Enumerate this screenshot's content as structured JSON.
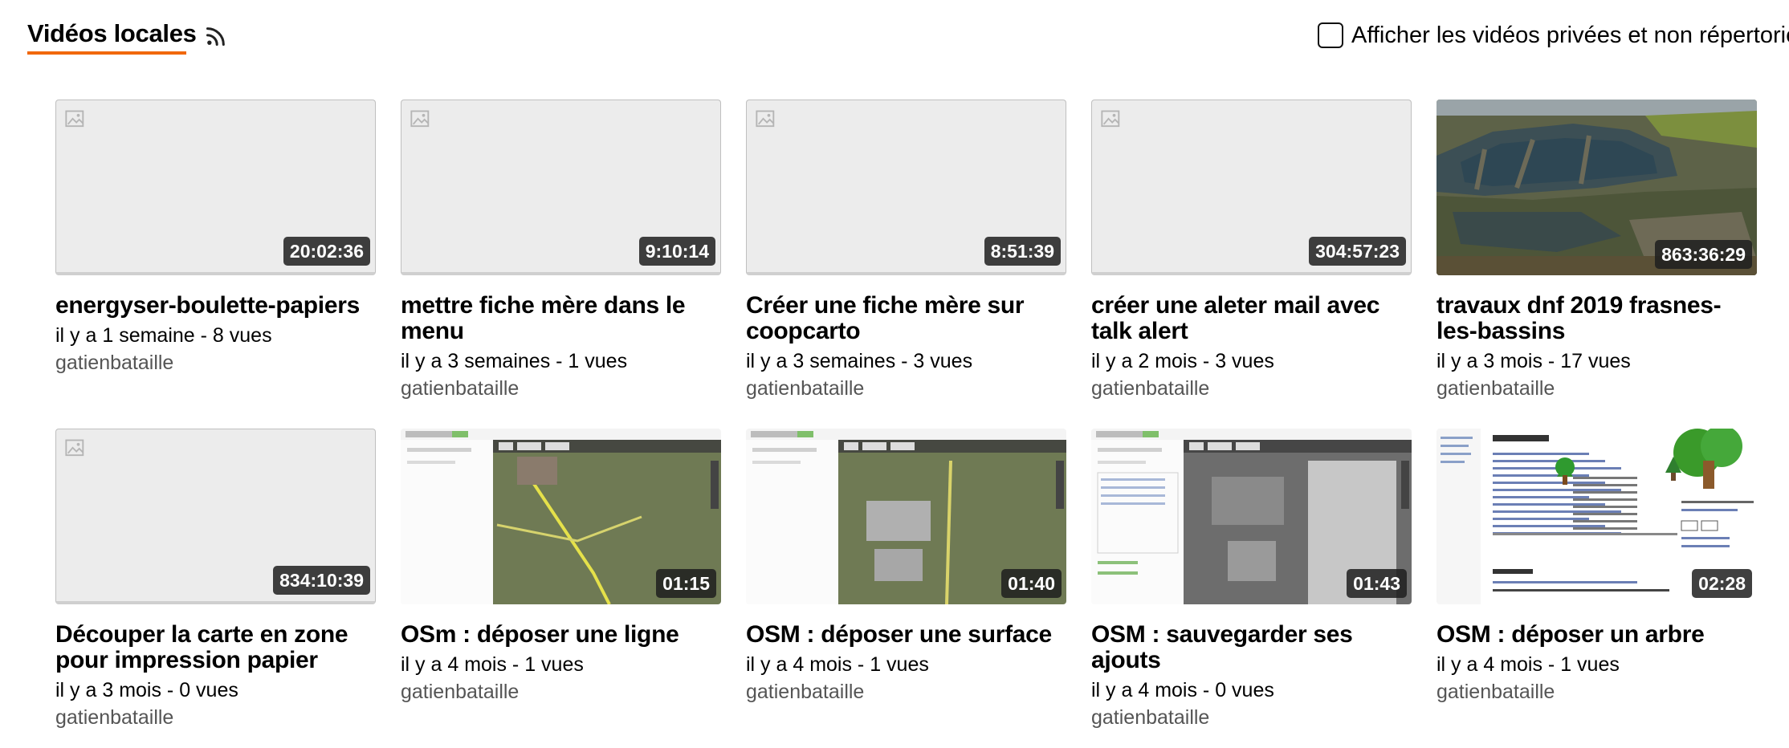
{
  "header": {
    "title": "Vidéos locales",
    "rss_icon": "rss-feed-icon",
    "private_toggle_label": "Afficher les vidéos privées et non répertoriées",
    "private_toggle_checked": false
  },
  "colors": {
    "accent": "#f1680d",
    "duration_bg": "#2b2b2b",
    "placeholder_bg": "#ececec"
  },
  "videos": [
    {
      "title": "energyser-boulette-papiers",
      "meta": "il y a 1 semaine - 8 vues",
      "channel": "gatienbataille",
      "duration": "20:02:36",
      "thumb": "placeholder"
    },
    {
      "title": "mettre fiche mère dans le menu",
      "meta": "il y a 3 semaines - 1 vues",
      "channel": "gatienbataille",
      "duration": "9:10:14",
      "thumb": "placeholder"
    },
    {
      "title": "Créer une fiche mère sur coopcarto",
      "meta": "il y a 3 semaines - 3 vues",
      "channel": "gatienbataille",
      "duration": "8:51:39",
      "thumb": "placeholder"
    },
    {
      "title": "créer une aleter mail avec talk alert",
      "meta": "il y a 2 mois - 3 vues",
      "channel": "gatienbataille",
      "duration": "304:57:23",
      "thumb": "placeholder"
    },
    {
      "title": "travaux dnf 2019 frasnes-les-bassins",
      "meta": "il y a 3 mois - 17 vues",
      "channel": "gatienbataille",
      "duration": "863:36:29",
      "thumb": "aerial-ponds"
    },
    {
      "title": "Découper la carte en zone pour impression papier",
      "meta": "il y a 3 mois - 0 vues",
      "channel": "gatienbataille",
      "duration": "834:10:39",
      "thumb": "placeholder"
    },
    {
      "title": "OSm : déposer une ligne",
      "meta": "il y a 4 mois - 1 vues",
      "channel": "gatienbataille",
      "duration": "01:15",
      "thumb": "map-screen-line"
    },
    {
      "title": "OSM : déposer une surface",
      "meta": "il y a 4 mois - 1 vues",
      "channel": "gatienbataille",
      "duration": "01:40",
      "thumb": "map-screen-surface"
    },
    {
      "title": "OSM : sauvegarder ses ajouts",
      "meta": "il y a 4 mois - 0 vues",
      "channel": "gatienbataille",
      "duration": "01:43",
      "thumb": "map-screen-save"
    },
    {
      "title": "OSM : déposer un arbre",
      "meta": "il y a 4 mois - 1 vues",
      "channel": "gatienbataille",
      "duration": "02:28",
      "thumb": "wiki-page-tree"
    }
  ]
}
